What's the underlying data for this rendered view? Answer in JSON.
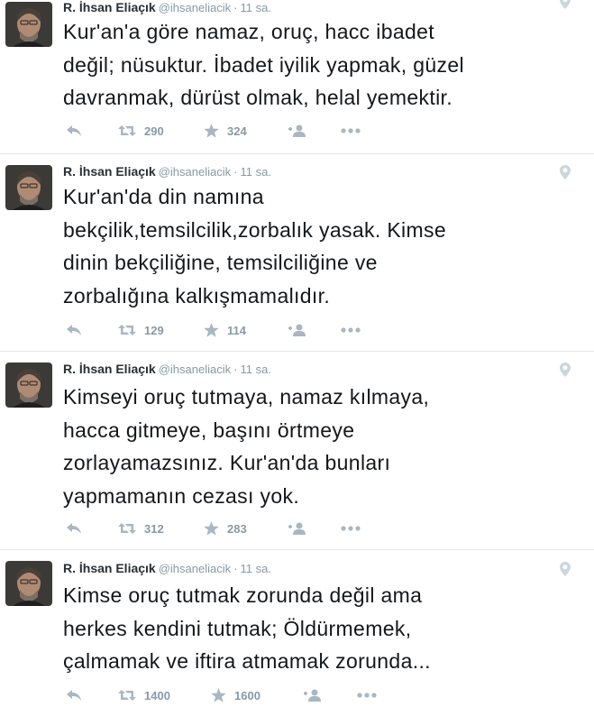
{
  "colors": {
    "text": "#14171a",
    "muted": "#8899a6",
    "icon": "#a9b7c2",
    "divider": "#e1e8ed"
  },
  "tweets": [
    {
      "name": "R. İhsan Eliaçık",
      "handle": "@ihsaneliacik",
      "separator": "·",
      "time": "11 sa.",
      "text": "Kur'an'a göre namaz, oruç, hacc ibadet\ndeğil; nüsuktur. İbadet iyilik yapmak, güzel\ndavranmak, dürüst olmak, helal yemektir.",
      "retweets": "290",
      "favorites": "324"
    },
    {
      "name": "R. İhsan Eliaçık",
      "handle": "@ihsaneliacik",
      "separator": "·",
      "time": "11 sa.",
      "text": "Kur'an'da din namına\nbekçilik,temsilcilik,zorbalık yasak. Kimse\ndinin bekçiliğine, temsilciliğine ve\nzorbalığına kalkışmamalıdır.",
      "retweets": "129",
      "favorites": "114"
    },
    {
      "name": "R. İhsan Eliaçık",
      "handle": "@ihsaneliacik",
      "separator": "·",
      "time": "11 sa.",
      "text": "Kimseyi oruç tutmaya, namaz kılmaya,\nhacca gitmeye, başını örtmeye\nzorlayamazsınız. Kur'an'da bunları\nyapmamanın cezası yok.",
      "retweets": "312",
      "favorites": "283"
    },
    {
      "name": "R. İhsan Eliaçık",
      "handle": "@ihsaneliacik",
      "separator": "·",
      "time": "11 sa.",
      "text": "Kimse oruç tutmak zorunda değil ama\nherkes kendini tutmak; Öldürmemek,\nçalmamak ve iftira atmamak zorunda...",
      "retweets": "1400",
      "favorites": "1600"
    }
  ],
  "icons": {
    "avatar": "profile-photo",
    "pin": "location-pin-icon",
    "reply": "reply-icon",
    "retweet": "retweet-icon",
    "favorite": "star-icon",
    "follow": "follow-user-icon",
    "more": "more-dots-icon"
  }
}
